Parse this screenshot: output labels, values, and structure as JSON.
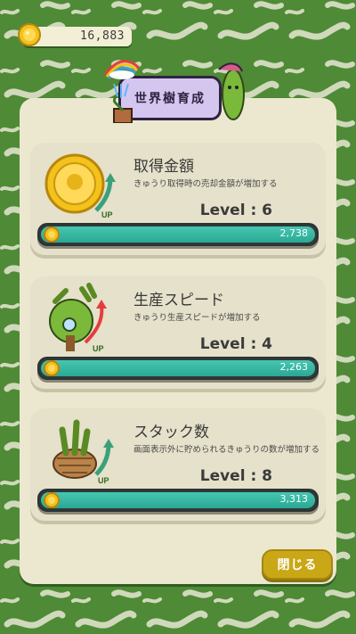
{
  "colors": {
    "background": "#4f8a36",
    "panel": "#ece8cf",
    "card": "#e5e1ca",
    "button_fill": "#2aa894",
    "button_border": "#2f3a38",
    "close_button": "#c9a717",
    "title_plate": "#d4c6ef"
  },
  "header": {
    "coin_amount": "16,883",
    "title": "世界樹育成"
  },
  "upgrades": [
    {
      "name": "取得金額",
      "description": "きゅうり取得時の売却金額が増加する",
      "level": "Level : 6",
      "price": "2,738",
      "icon": "gold-medal-up-icon"
    },
    {
      "name": "生産スピード",
      "description": "きゅうり生産スピードが増加する",
      "level": "Level : 4",
      "price": "2,263",
      "icon": "tree-speed-up-icon"
    },
    {
      "name": "スタック数",
      "description": "画面表示外に貯められるきゅうりの数が増加する",
      "level": "Level : 8",
      "price": "3,313",
      "icon": "basket-stack-up-icon"
    }
  ],
  "close_label": "閉じる"
}
